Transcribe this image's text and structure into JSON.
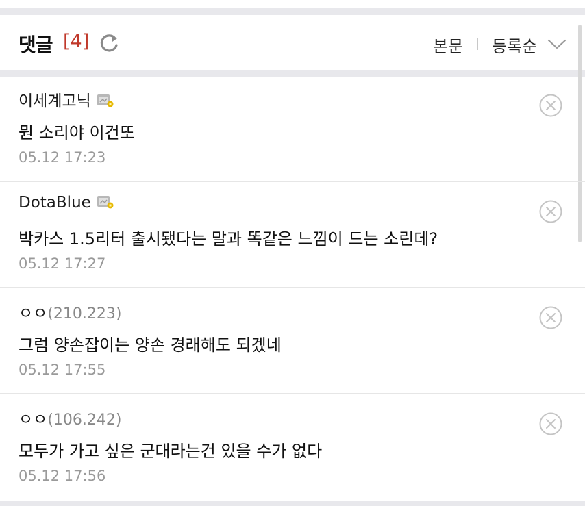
{
  "header": {
    "title": "댓글",
    "count": "[4]",
    "refresh_icon": "refresh-icon",
    "link_body": "본문",
    "sort_label": "등록순",
    "sort_icon": "chevron-down-icon"
  },
  "colors": {
    "accent_count": "#c0392b",
    "band": "#e8e8ec",
    "time_text": "#9a9a9a"
  },
  "comments": [
    {
      "author": "이세계고닉",
      "ip": "",
      "member_icon": "member-badge-icon",
      "text": "뭔 소리야 이건또",
      "time": "05.12 17:23"
    },
    {
      "author": "DotaBlue",
      "ip": "",
      "member_icon": "member-badge-icon",
      "text": "박카스 1.5리터 출시됐다는 말과 똑같은 느낌이 드는 소린데?",
      "time": "05.12 17:27"
    },
    {
      "author": "ㅇㅇ",
      "ip": "(210.223)",
      "text": "그럼 양손잡이는 양손 경래해도 되겠네",
      "time": "05.12 17:55"
    },
    {
      "author": "ㅇㅇ",
      "ip": "(106.242)",
      "text": "모두가 가고 싶은 군대라는건 있을 수가 없다",
      "time": "05.12 17:56"
    }
  ]
}
